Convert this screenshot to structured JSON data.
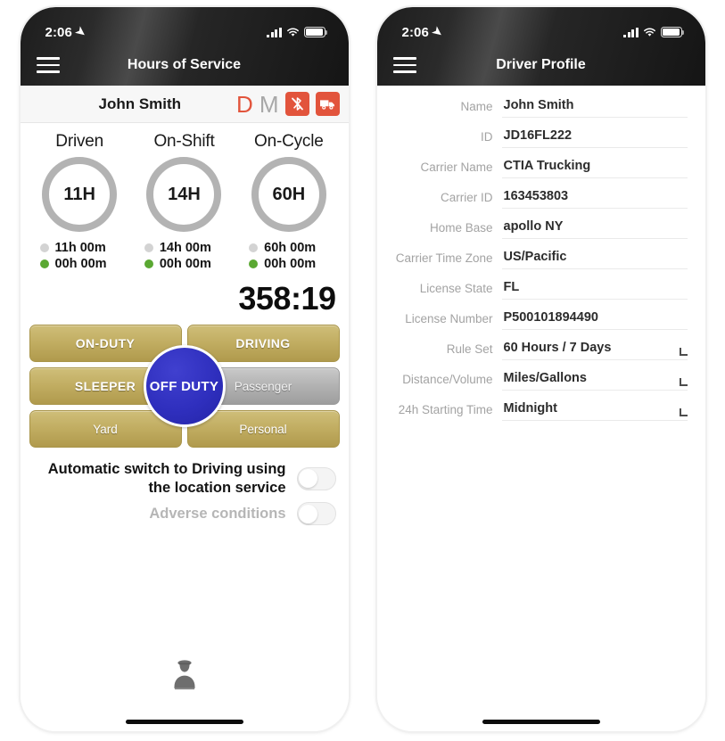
{
  "phones": {
    "left": {
      "status_bar": {
        "time": "2:06",
        "location_arrow_icon": "location-arrow-icon",
        "signal_icon": "cellular-signal-icon",
        "wifi_icon": "wifi-icon",
        "battery_icon": "battery-icon"
      },
      "nav": {
        "menu_icon": "hamburger-menu-icon",
        "title": "Hours of Service"
      },
      "header": {
        "driver_name": "John Smith",
        "badge_d": "D",
        "badge_m": "M",
        "bluetooth_icon": "bluetooth-disabled-icon",
        "truck_icon": "truck-icon"
      },
      "gauges": [
        {
          "label": "Driven",
          "ring_value": "11H",
          "remaining": "11h 00m",
          "used": "00h 00m"
        },
        {
          "label": "On-Shift",
          "ring_value": "14H",
          "remaining": "14h 00m",
          "used": "00h 00m"
        },
        {
          "label": "On-Cycle",
          "ring_value": "60H",
          "remaining": "60h 00m",
          "used": "00h 00m"
        }
      ],
      "timer": "358:19",
      "duty": {
        "on_duty": "ON-DUTY",
        "driving": "DRIVING",
        "sleeper": "SLEEPER",
        "passenger": "Passenger",
        "yard": "Yard",
        "personal": "Personal",
        "center": "OFF DUTY"
      },
      "toggles": [
        {
          "label": "Automatic switch to Driving using the location service",
          "state": "off",
          "disabled": false
        },
        {
          "label": "Adverse conditions",
          "state": "off",
          "disabled": true
        }
      ],
      "footer": {
        "driver_icon": "driver-person-icon"
      }
    },
    "right": {
      "status_bar": {
        "time": "2:06",
        "location_arrow_icon": "location-arrow-icon",
        "signal_icon": "cellular-signal-icon",
        "wifi_icon": "wifi-icon",
        "battery_icon": "battery-icon"
      },
      "nav": {
        "menu_icon": "hamburger-menu-icon",
        "title": "Driver Profile"
      },
      "fields": [
        {
          "label": "Name",
          "value": "John Smith",
          "selectable": false
        },
        {
          "label": "ID",
          "value": "JD16FL222",
          "selectable": false
        },
        {
          "label": "Carrier Name",
          "value": "CTIA Trucking",
          "selectable": false
        },
        {
          "label": "Carrier ID",
          "value": "163453803",
          "selectable": false
        },
        {
          "label": "Home Base",
          "value": "apollo NY",
          "selectable": false
        },
        {
          "label": "Carrier Time Zone",
          "value": "US/Pacific",
          "selectable": false
        },
        {
          "label": "License State",
          "value": "FL",
          "selectable": false
        },
        {
          "label": "License Number",
          "value": "P500101894490",
          "selectable": false
        },
        {
          "label": "Rule Set",
          "value": "60 Hours / 7 Days",
          "selectable": true
        },
        {
          "label": "Distance/Volume",
          "value": "Miles/Gallons",
          "selectable": true
        },
        {
          "label": "24h Starting Time",
          "value": "Midnight",
          "selectable": true
        }
      ]
    }
  },
  "colors": {
    "accent_red": "#e2543c",
    "duty_gold": "#c2ae63",
    "off_duty_blue": "#2f2fbe",
    "legend_green": "#5aa832",
    "ring_gray": "#b3b3b3"
  }
}
